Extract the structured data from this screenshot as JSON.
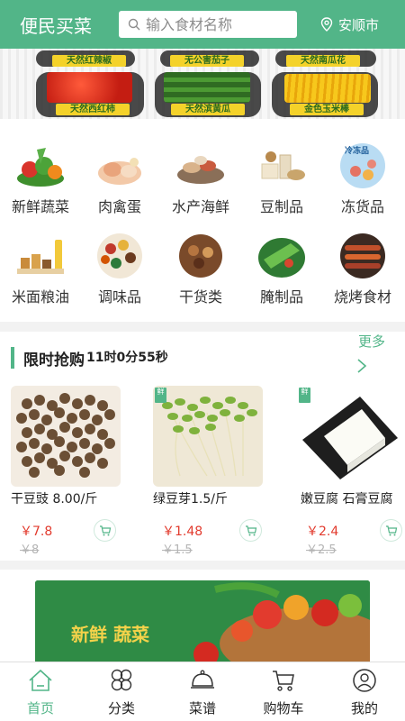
{
  "header": {
    "title": "便民买菜",
    "search_placeholder": "输入食材名称",
    "location": "安顺市"
  },
  "banner": {
    "labels": [
      "天然红辣椒",
      "无公害茄子",
      "天然南瓜花",
      "天然西红柿",
      "天然滨黄瓜",
      "金色玉米棒"
    ]
  },
  "categories": [
    {
      "label": "新鲜蔬菜",
      "icon": "vegetables-icon"
    },
    {
      "label": "肉禽蛋",
      "icon": "meat-poultry-icon"
    },
    {
      "label": "水产海鲜",
      "icon": "seafood-icon"
    },
    {
      "label": "豆制品",
      "icon": "soy-products-icon"
    },
    {
      "label": "冻货品",
      "icon": "frozen-goods-icon",
      "badge": "冷冻品"
    },
    {
      "label": "米面粮油",
      "icon": "grain-oil-icon"
    },
    {
      "label": "调味品",
      "icon": "seasoning-icon"
    },
    {
      "label": "干货类",
      "icon": "dry-goods-icon"
    },
    {
      "label": "腌制品",
      "icon": "pickled-icon"
    },
    {
      "label": "烧烤食材",
      "icon": "bbq-icon"
    }
  ],
  "flash_sale": {
    "title": "限时抢购",
    "countdown": "11时0分55秒",
    "more": "更多",
    "tag": "鲜",
    "items": [
      {
        "name": "干豆豉 8.00/斤",
        "price": "￥7.8",
        "old_price": "￥8"
      },
      {
        "name": "绿豆芽1.5/斤",
        "price": "￥1.48",
        "old_price": "￥1.5"
      },
      {
        "name": "嫩豆腐 石膏豆腐",
        "price": "￥2.4",
        "old_price": "￥2.5"
      }
    ]
  },
  "promo": {
    "text": "新鲜  蔬菜"
  },
  "nav": [
    {
      "label": "首页",
      "icon": "home-icon",
      "active": true
    },
    {
      "label": "分类",
      "icon": "category-icon",
      "active": false
    },
    {
      "label": "菜谱",
      "icon": "recipe-icon",
      "active": false
    },
    {
      "label": "购物车",
      "icon": "cart-icon",
      "active": false
    },
    {
      "label": "我的",
      "icon": "profile-icon",
      "active": false
    }
  ],
  "colors": {
    "brand": "#52b588",
    "price": "#e23b2e",
    "old_price": "#b5b5b5"
  }
}
